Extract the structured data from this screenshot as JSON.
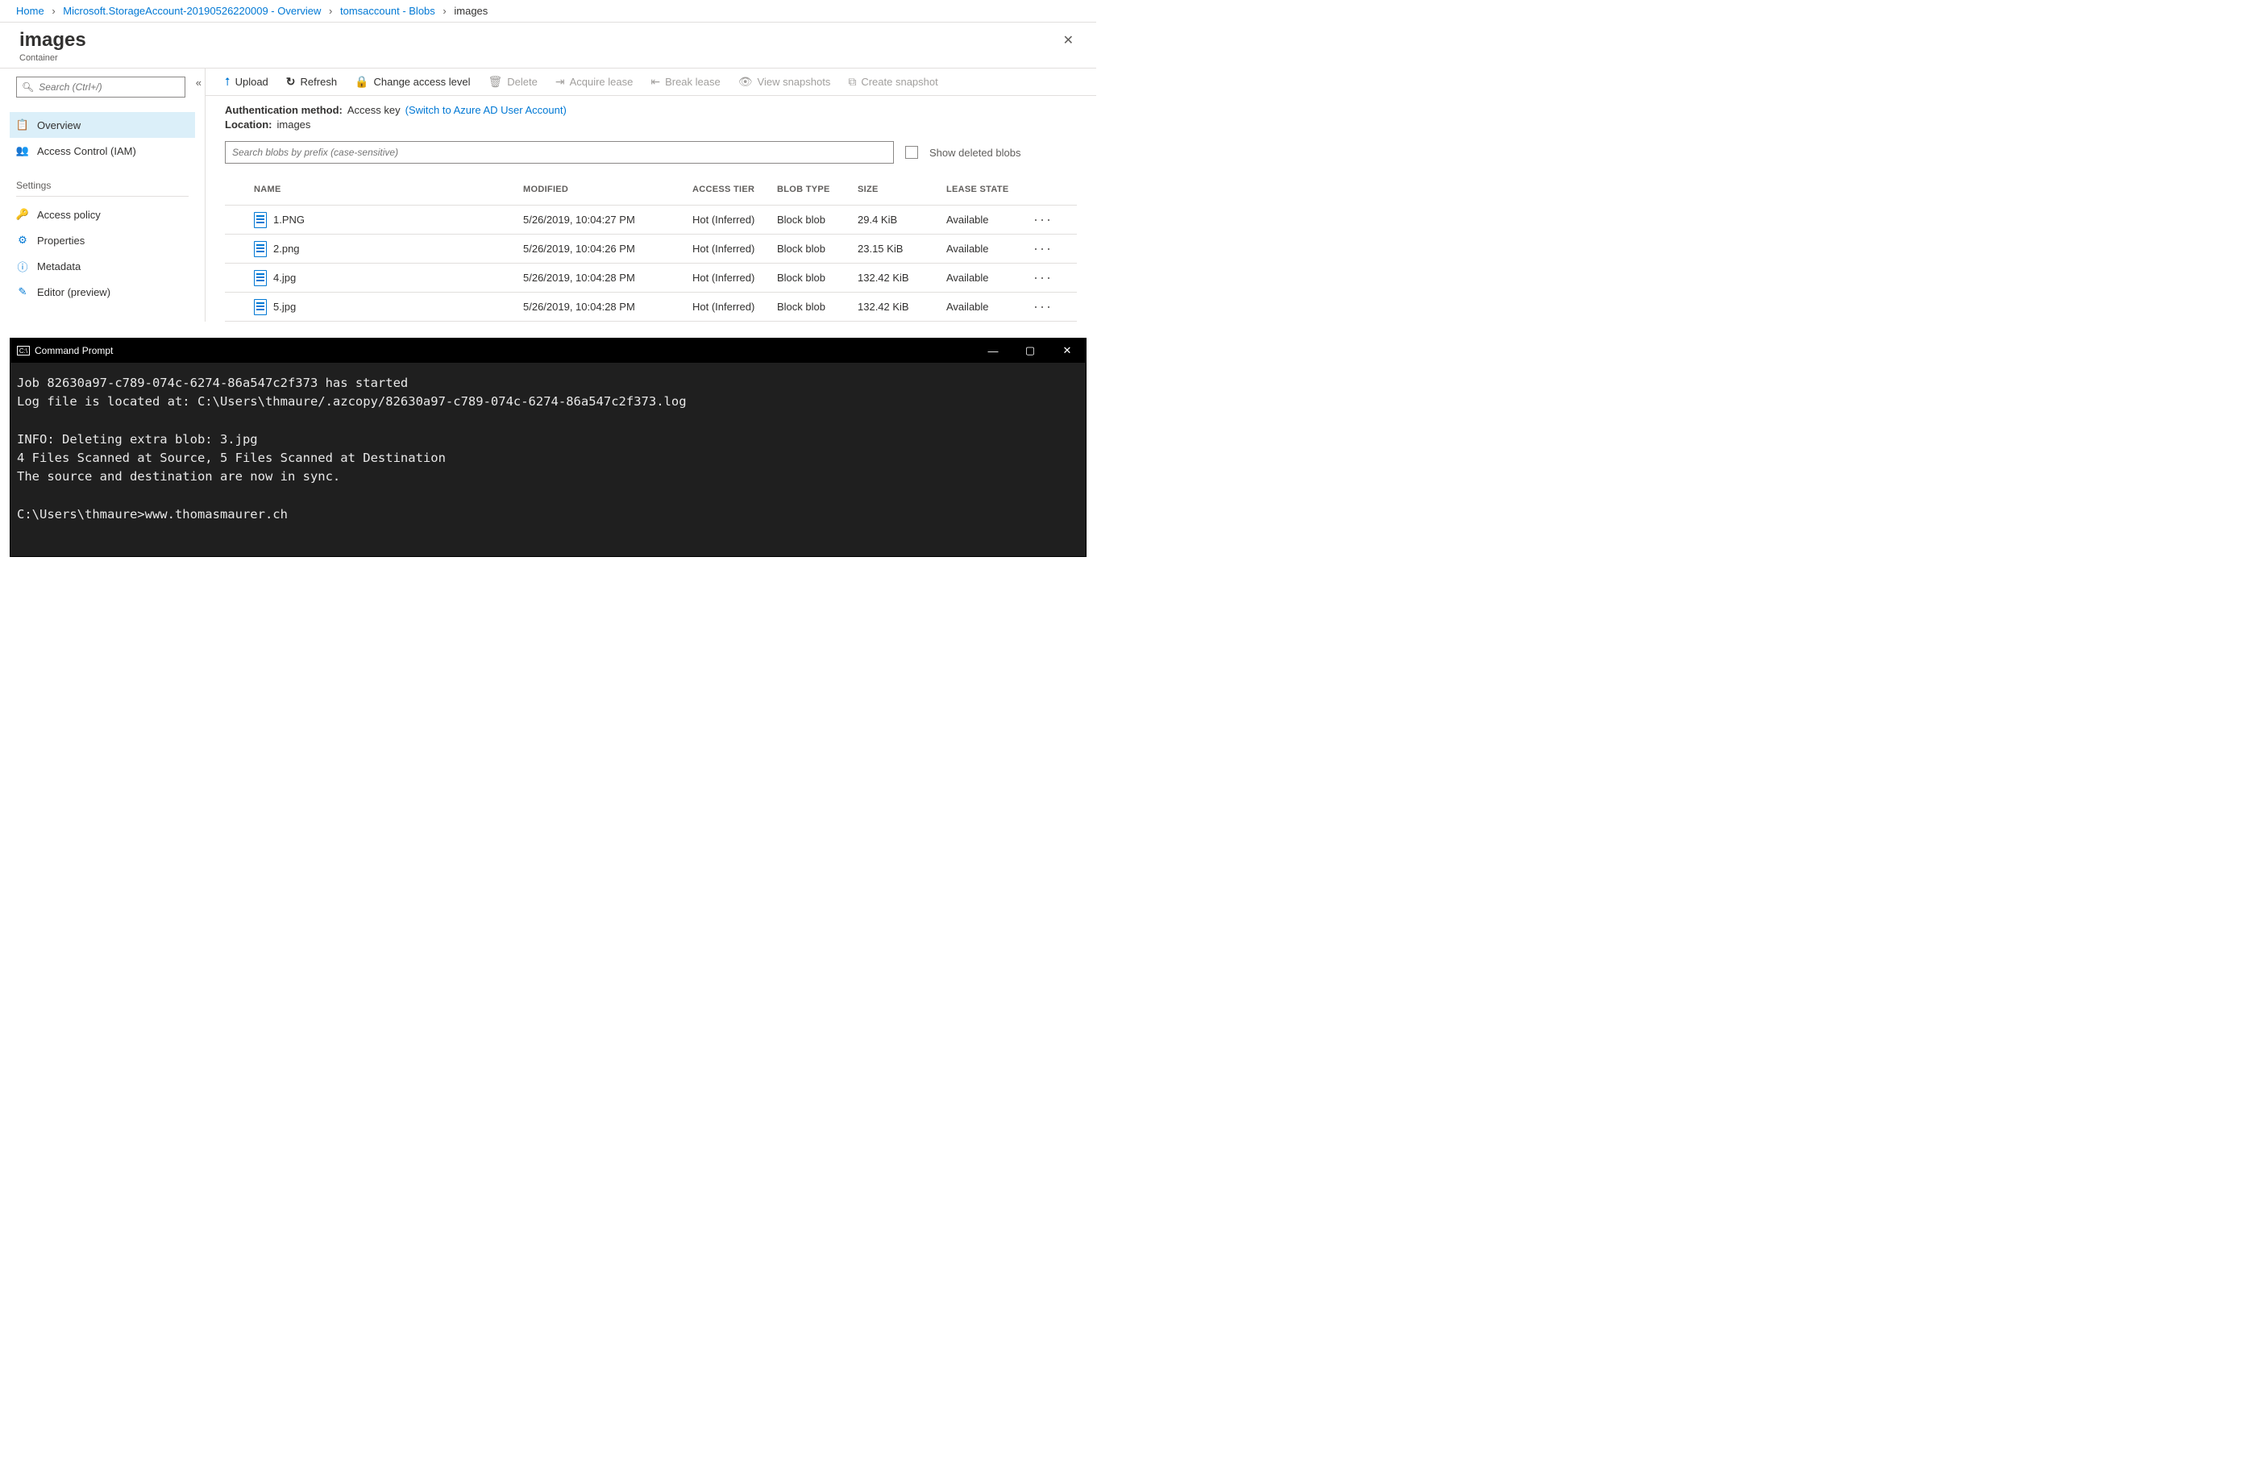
{
  "breadcrumb": {
    "home": "Home",
    "crumb1": "Microsoft.StorageAccount-20190526220009 - Overview",
    "crumb2": "tomsaccount - Blobs",
    "current": "images"
  },
  "header": {
    "title": "images",
    "subtitle": "Container"
  },
  "sidebar": {
    "search_placeholder": "Search (Ctrl+/)",
    "overview": "Overview",
    "access_control": "Access Control (IAM)",
    "settings_label": "Settings",
    "access_policy": "Access policy",
    "properties": "Properties",
    "metadata": "Metadata",
    "editor": "Editor (preview)"
  },
  "toolbar": {
    "upload": "Upload",
    "refresh": "Refresh",
    "change_access": "Change access level",
    "delete": "Delete",
    "acquire_lease": "Acquire lease",
    "break_lease": "Break lease",
    "view_snapshots": "View snapshots",
    "create_snapshot": "Create snapshot"
  },
  "meta": {
    "auth_label": "Authentication method:",
    "auth_value": "Access key",
    "auth_switch": "(Switch to Azure AD User Account)",
    "location_label": "Location:",
    "location_value": "images"
  },
  "filter": {
    "blob_search_placeholder": "Search blobs by prefix (case-sensitive)",
    "show_deleted": "Show deleted blobs"
  },
  "table": {
    "columns": {
      "name": "NAME",
      "modified": "MODIFIED",
      "access_tier": "ACCESS TIER",
      "blob_type": "BLOB TYPE",
      "size": "SIZE",
      "lease_state": "LEASE STATE"
    },
    "rows": [
      {
        "name": "1.PNG",
        "modified": "5/26/2019, 10:04:27 PM",
        "tier": "Hot (Inferred)",
        "type": "Block blob",
        "size": "29.4 KiB",
        "lease": "Available"
      },
      {
        "name": "2.png",
        "modified": "5/26/2019, 10:04:26 PM",
        "tier": "Hot (Inferred)",
        "type": "Block blob",
        "size": "23.15 KiB",
        "lease": "Available"
      },
      {
        "name": "4.jpg",
        "modified": "5/26/2019, 10:04:28 PM",
        "tier": "Hot (Inferred)",
        "type": "Block blob",
        "size": "132.42 KiB",
        "lease": "Available"
      },
      {
        "name": "5.jpg",
        "modified": "5/26/2019, 10:04:28 PM",
        "tier": "Hot (Inferred)",
        "type": "Block blob",
        "size": "132.42 KiB",
        "lease": "Available"
      }
    ]
  },
  "cmd": {
    "title": "Command Prompt",
    "body": "Job 82630a97-c789-074c-6274-86a547c2f373 has started\nLog file is located at: C:\\Users\\thmaure/.azcopy/82630a97-c789-074c-6274-86a547c2f373.log\n\nINFO: Deleting extra blob: 3.jpg\n4 Files Scanned at Source, 5 Files Scanned at Destination\nThe source and destination are now in sync.\n\nC:\\Users\\thmaure>www.thomasmaurer.ch"
  }
}
